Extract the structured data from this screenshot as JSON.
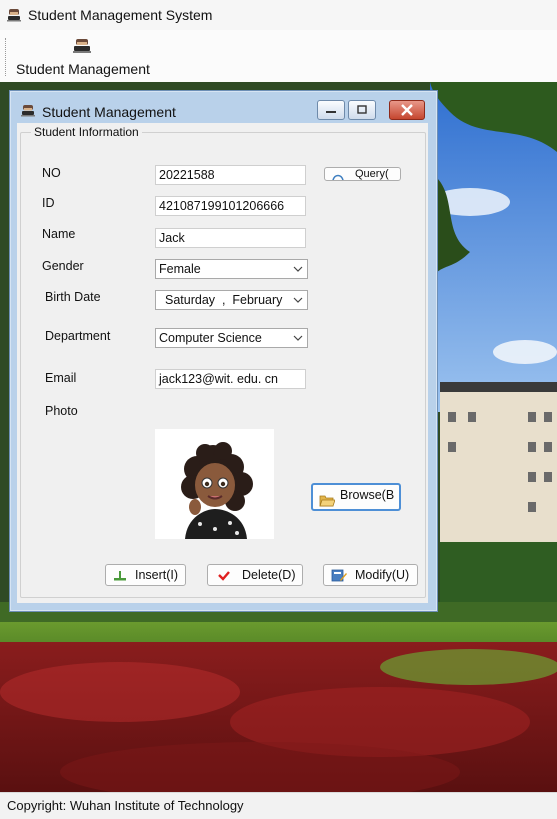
{
  "app": {
    "title": "Student Management System"
  },
  "toolbar": {
    "button_label": "Student Management"
  },
  "child_window": {
    "title": "Student Management",
    "group_title": "Student Information"
  },
  "form": {
    "no_label": "NO",
    "no_value": "20221588",
    "id_label": "ID",
    "id_value": "421087199101206666",
    "name_label": "Name",
    "name_value": "Jack",
    "gender_label": "Gender",
    "gender_value": "Female",
    "birth_label": "Birth Date",
    "birth_value": "Saturday  ,  February",
    "dept_label": "Department",
    "dept_value": "Computer Science",
    "email_label": "Email",
    "email_value": "jack123@wit. edu. cn",
    "photo_label": "Photo"
  },
  "buttons": {
    "query": "Query(",
    "browse": "Browse(B",
    "insert": "Insert(I)",
    "delete": "Delete(D)",
    "modify": "Modify(U)"
  },
  "status": {
    "text": "Copyright: Wuhan Institute of Technology"
  },
  "colors": {
    "titlebar_bg": "#f6f6f6",
    "child_frame": "#b9d1ea",
    "close_button": "#c5462f",
    "client_bg": "#f0f0f0"
  },
  "icons": {
    "app": "student-icon",
    "toolbar": "student-icon",
    "insert": "insert-icon",
    "delete": "red-check-icon",
    "modify": "edit-icon",
    "browse": "folder-open-icon",
    "query": "search-icon"
  }
}
